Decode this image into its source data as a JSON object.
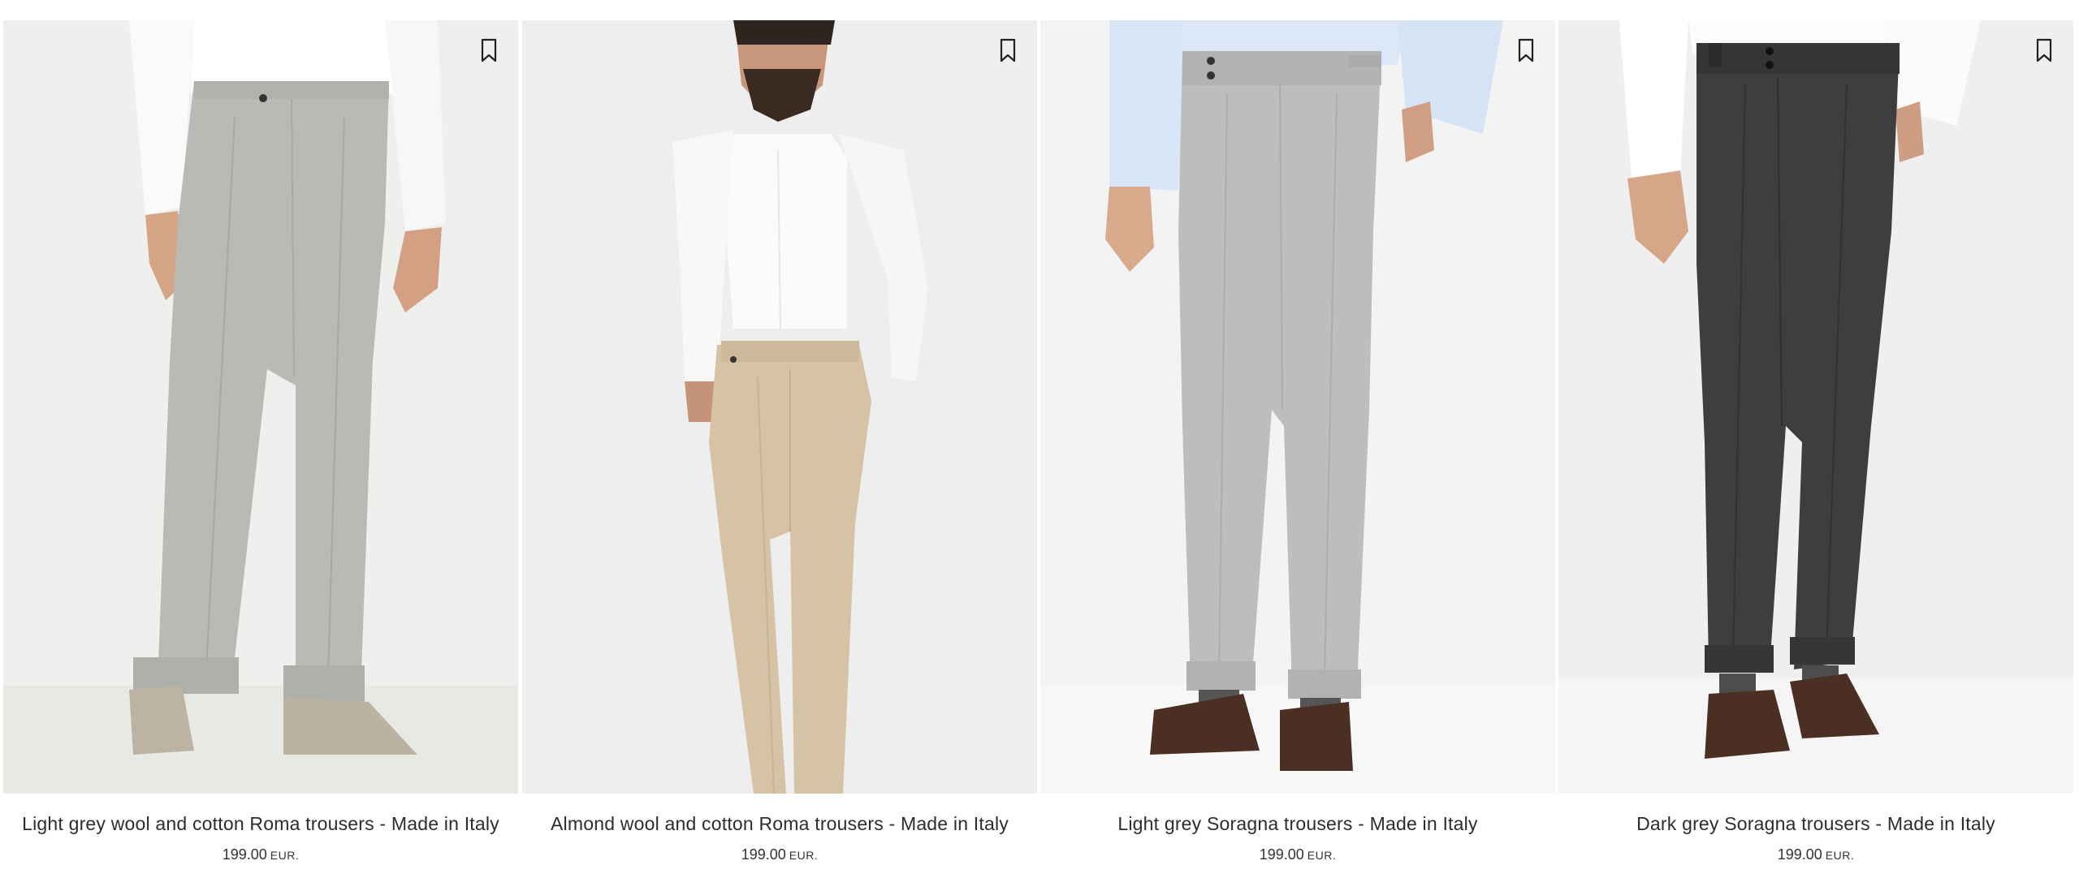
{
  "products": [
    {
      "name": "Light grey wool and cotton Roma trousers - Made in Italy",
      "price": "199.00",
      "currency": "EUR.",
      "trouser_color": "#b8bab6",
      "photo_bg": "#eceeeb",
      "shoe_color": "#bdb3a3",
      "bookmark_icon": "bookmark-icon"
    },
    {
      "name": "Almond wool and cotton Roma trousers - Made in Italy",
      "price": "199.00",
      "currency": "EUR.",
      "trouser_color": "#d6c3a5",
      "photo_bg": "#efeeef",
      "shirt_color": "#fbfbfb",
      "bookmark_icon": "bookmark-icon"
    },
    {
      "name": "Light grey Soragna trousers - Made in Italy",
      "price": "199.00",
      "currency": "EUR.",
      "trouser_color": "#bdbdbd",
      "photo_bg": "#f3f3f3",
      "shirt_color": "#d9e6f7",
      "shoe_color": "#4a2f22",
      "bookmark_icon": "bookmark-icon"
    },
    {
      "name": "Dark grey Soragna trousers - Made in Italy",
      "price": "199.00",
      "currency": "EUR.",
      "trouser_color": "#3e3e3e",
      "photo_bg": "#efefef",
      "shirt_color": "#ffffff",
      "shoe_color": "#4a2f22",
      "bookmark_icon": "bookmark-icon"
    }
  ]
}
